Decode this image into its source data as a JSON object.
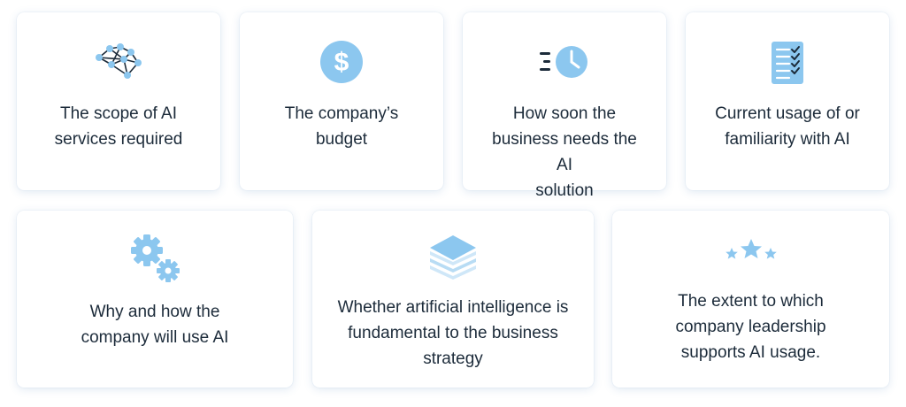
{
  "colors": {
    "icon_light": "#8cc7ef",
    "icon_dark": "#1c2b3a",
    "text": "#1c2b3a",
    "card_bg": "#ffffff"
  },
  "cards": [
    {
      "icon": "neural-network-icon",
      "text": "The scope of AI\nservices required"
    },
    {
      "icon": "dollar-icon",
      "text": "The company’s\nbudget"
    },
    {
      "icon": "fast-clock-icon",
      "text": "How soon the\nbusiness needs the AI\nsolution"
    },
    {
      "icon": "checklist-icon",
      "text": "Current usage of or\nfamiliarity with AI"
    },
    {
      "icon": "gears-icon",
      "text": "Why and how the\ncompany will use AI"
    },
    {
      "icon": "layers-icon",
      "text": "Whether artificial intelligence is\nfundamental to the business\nstrategy"
    },
    {
      "icon": "stars-icon",
      "text": "The extent to which\ncompany leadership\nsupports AI usage."
    }
  ]
}
